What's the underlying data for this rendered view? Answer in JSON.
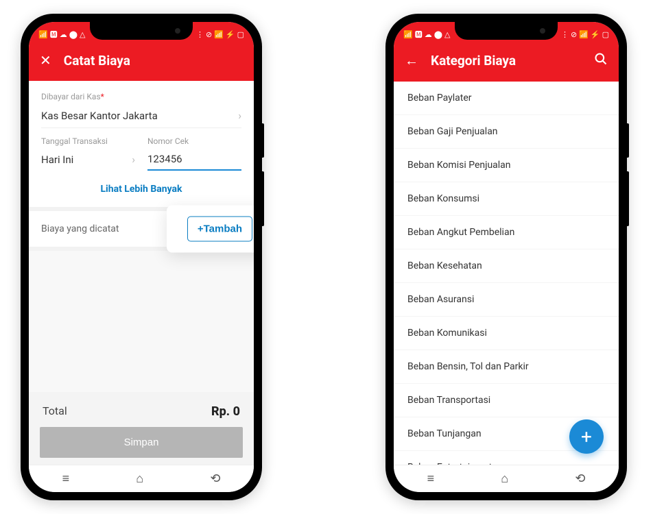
{
  "phone1": {
    "header": {
      "title": "Catat Biaya"
    },
    "fields": {
      "kas_label": "Dibayar dari Kas",
      "kas_value": "Kas Besar Kantor Jakarta",
      "tgl_label": "Tanggal Transaksi",
      "tgl_value": "Hari Ini",
      "cek_label": "Nomor Cek",
      "cek_value": "123456"
    },
    "link_more": "Lihat Lebih Banyak",
    "section": {
      "label": "Biaya yang dicatat",
      "add_btn": "+Tambah"
    },
    "footer": {
      "total_label": "Total",
      "total_value": "Rp. 0",
      "save": "Simpan"
    }
  },
  "phone2": {
    "header": {
      "title": "Kategori Biaya"
    },
    "categories": [
      "Beban Paylater",
      "Beban Gaji Penjualan",
      "Beban Komisi Penjualan",
      "Beban Konsumsi",
      "Beban Angkut Pembelian",
      "Beban Kesehatan",
      "Beban Asuransi",
      "Beban Komunikasi",
      "Beban Bensin, Tol dan Parkir",
      "Beban Transportasi",
      "Beban Tunjangan",
      "Beban Entertaiment"
    ],
    "fab": "+"
  }
}
